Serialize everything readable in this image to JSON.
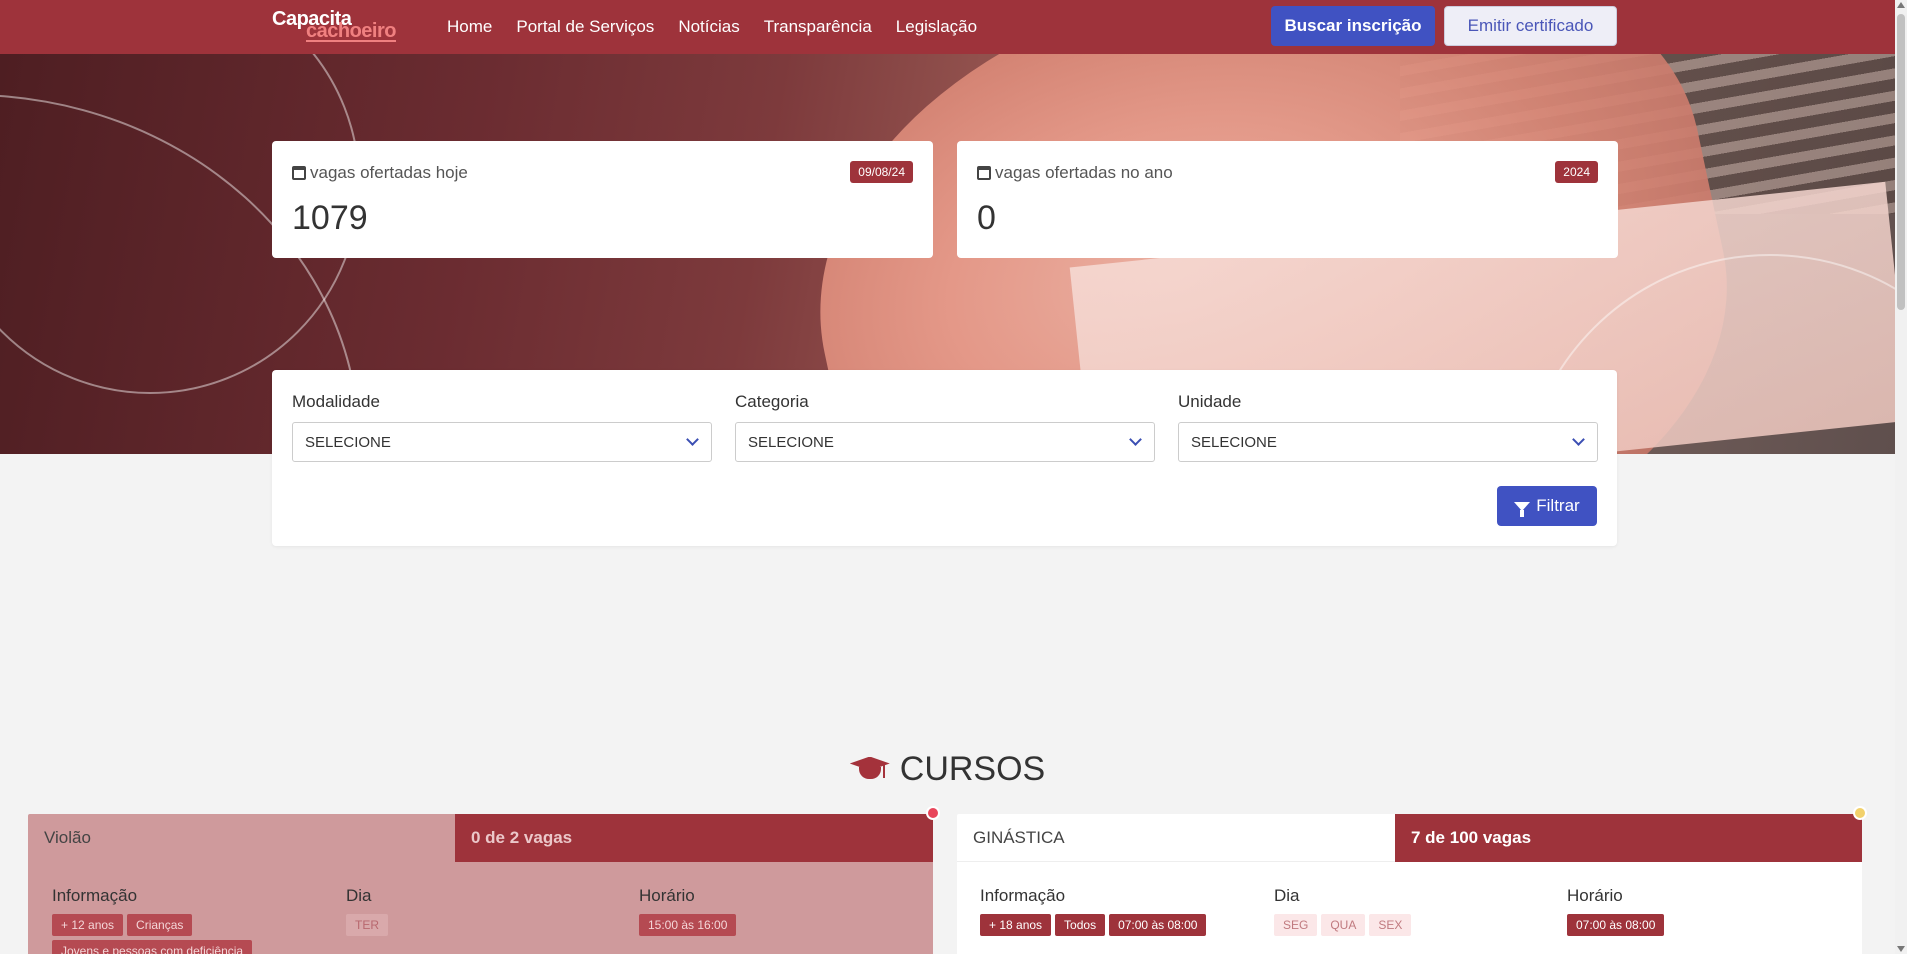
{
  "brand": {
    "line1": "Capacita",
    "line2": "cachoeiro"
  },
  "nav": {
    "links": [
      "Home",
      "Portal de Serviços",
      "Notícias",
      "Transparência",
      "Legislação"
    ],
    "buscar_label": "Buscar inscrição",
    "emitir_label": "Emitir certificado"
  },
  "stats": {
    "today": {
      "label": "vagas ofertadas hoje",
      "badge": "09/08/24",
      "value": "1079",
      "icon": "calendar-check-icon"
    },
    "year": {
      "label": "vagas ofertadas no ano",
      "badge": "2024",
      "value": "0",
      "icon": "calendar-icon"
    }
  },
  "filters": {
    "modalidade": {
      "label": "Modalidade",
      "value": "SELECIONE"
    },
    "categoria": {
      "label": "Categoria",
      "value": "SELECIONE"
    },
    "unidade": {
      "label": "Unidade",
      "value": "SELECIONE"
    },
    "button_label": "Filtrar",
    "button_icon": "funnel-icon"
  },
  "cursos": {
    "title": "CURSOS",
    "icon": "graduation-cap-icon",
    "items": [
      {
        "name": "Violão",
        "vagas": "0 de 2 vagas",
        "info_title": "Informação",
        "dia_title": "Dia",
        "horario_title": "Horário",
        "info_tags": [
          "+ 12 anos",
          "Crianças",
          "Jovens e pessoas com deficiência"
        ],
        "dias": [
          "TER"
        ],
        "horarios": [
          "15:00 às 16:00"
        ],
        "status_color": "#e8455a"
      },
      {
        "name": "GINÁSTICA",
        "vagas": "7 de 100 vagas",
        "info_title": "Informação",
        "dia_title": "Dia",
        "horario_title": "Horário",
        "info_tags": [
          "+ 18 anos",
          "Todos",
          "07:00 às 08:00"
        ],
        "dias": [
          "SEG",
          "QUA",
          "SEX"
        ],
        "horarios": [
          "07:00 às 08:00"
        ],
        "status_color": "#f2d16b"
      }
    ]
  },
  "colors": {
    "brand": "#9e333b",
    "primary": "#4052c2"
  }
}
